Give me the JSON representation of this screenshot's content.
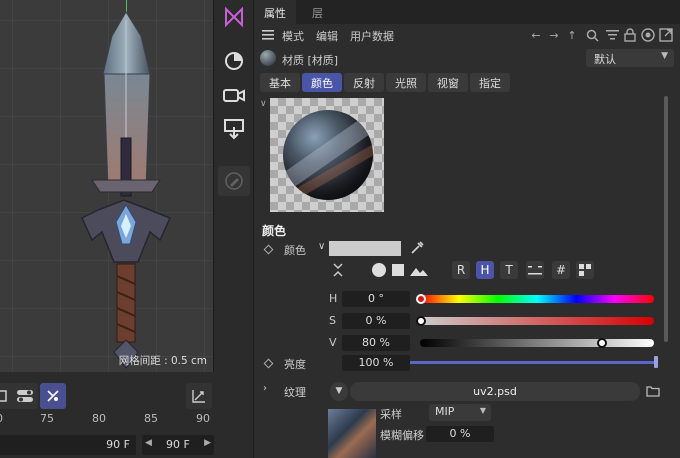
{
  "viewport": {
    "grid_readout": "网格间距 : 0.5 cm"
  },
  "timeline": {
    "ruler_ticks": [
      "0",
      "75",
      "80",
      "85",
      "90"
    ],
    "frame_end": "90 F",
    "frame_current": "90 F"
  },
  "iconstrip": {
    "icons": [
      "material-editor-icon",
      "sky-icon",
      "camera-icon",
      "render-icon",
      "edit-icon"
    ]
  },
  "panel": {
    "tabs": [
      "属性",
      "层"
    ],
    "menu": [
      "模式",
      "编辑",
      "用户数据"
    ],
    "title": "材质 [材质]",
    "preset": "默认",
    "subtabs": [
      "基本",
      "颜色",
      "反射",
      "光照",
      "视窗",
      "指定"
    ],
    "active_subtab": "颜色",
    "section": "颜色",
    "color_label": "颜色",
    "swatch_color": "#cccccc",
    "modes": [
      "R",
      "H",
      "T"
    ],
    "hsv": {
      "h_label": "H",
      "h_value": "0 °",
      "s_label": "S",
      "s_value": "0 %",
      "v_label": "V",
      "v_value": "80 %",
      "h_fraction": 0.0,
      "s_fraction": 0.0,
      "v_fraction": 0.8
    },
    "brightness_label": "亮度",
    "brightness_value": "100 %",
    "brightness_fraction": 1.0,
    "texture_label": "纹理",
    "texture_file": "uv2.psd",
    "sampling_label": "采样",
    "sampling_value": "MIP",
    "blur_offset_label": "模糊偏移",
    "blur_offset_value": "0 %",
    "accent_color": "#4b55a8"
  }
}
